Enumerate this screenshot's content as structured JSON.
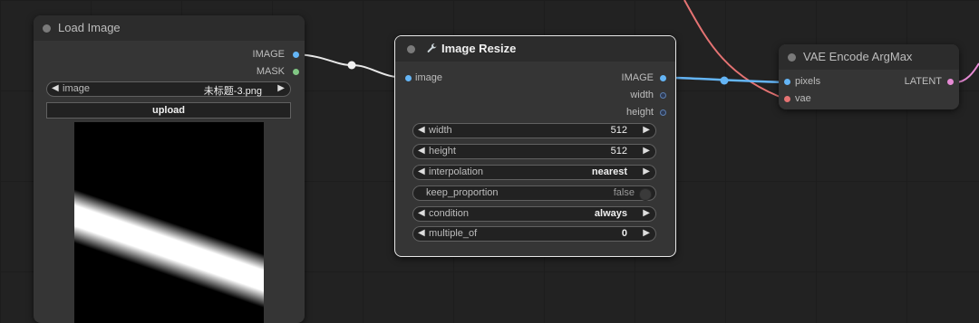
{
  "colors": {
    "canvas_bg": "#222222",
    "node_bg": "#353535",
    "image_link": "#64b5f6",
    "mask_link": "#81c784",
    "vae_link": "#e57373",
    "latent_link": "#e68ad4"
  },
  "load_image": {
    "title": "Load Image",
    "outputs": [
      {
        "label": "IMAGE",
        "type": "image"
      },
      {
        "label": "MASK",
        "type": "mask"
      }
    ],
    "image_widget": {
      "label": "image",
      "value": "未标题-3.png"
    },
    "upload_label": "upload"
  },
  "image_resize": {
    "title": "Image Resize",
    "icon": "wrench-icon",
    "inputs": [
      {
        "label": "image"
      }
    ],
    "outputs": [
      {
        "label": "IMAGE"
      },
      {
        "label": "width"
      },
      {
        "label": "height"
      }
    ],
    "widgets": [
      {
        "label": "width",
        "value": "512"
      },
      {
        "label": "height",
        "value": "512"
      },
      {
        "label": "interpolation",
        "value": "nearest"
      },
      {
        "label": "keep_proportion",
        "value": "false"
      },
      {
        "label": "condition",
        "value": "always"
      },
      {
        "label": "multiple_of",
        "value": "0"
      }
    ]
  },
  "vae_encode": {
    "title": "VAE Encode ArgMax",
    "inputs": [
      {
        "label": "pixels"
      },
      {
        "label": "vae"
      }
    ],
    "outputs": [
      {
        "label": "LATENT"
      }
    ]
  }
}
